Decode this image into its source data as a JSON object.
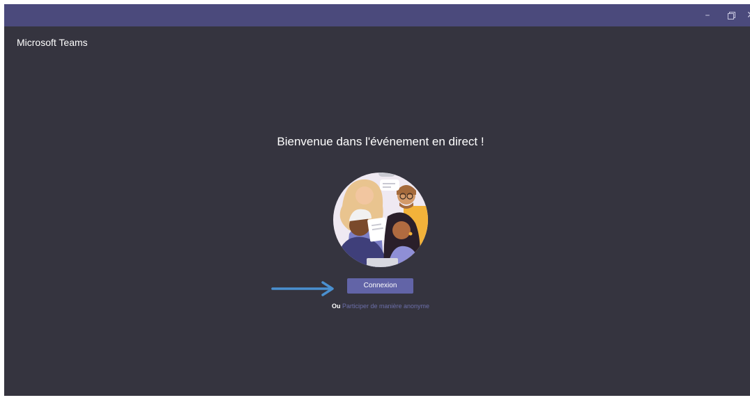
{
  "window": {
    "controls": {
      "minimize_icon": "minimize-icon",
      "restore_icon": "restore-icon",
      "close_icon": "close-icon"
    }
  },
  "app": {
    "title": "Microsoft Teams"
  },
  "main": {
    "welcome_text": "Bienvenue dans l'événement en direct !",
    "connect_label": "Connexion",
    "alt_prefix": "Ou",
    "alt_link_label": "Participer de manière anonyme"
  },
  "colors": {
    "background": "#35343f",
    "titlebar": "#4b4a7c",
    "button": "#6264a7",
    "link": "#6b6ea8",
    "annotation_arrow": "#4a90d0"
  }
}
